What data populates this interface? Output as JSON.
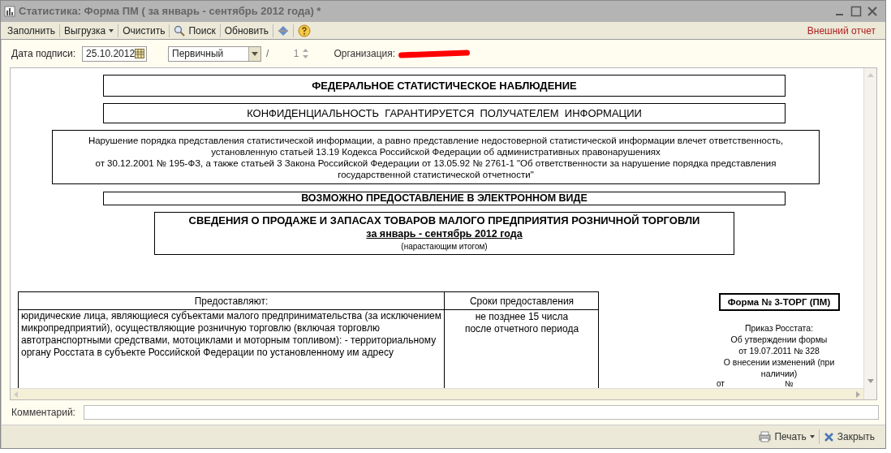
{
  "window": {
    "title": "Статистика: Форма ПМ ( за январь - сентябрь 2012 года) *"
  },
  "toolbar": {
    "items": [
      {
        "kind": "button",
        "label": "Заполнить"
      },
      {
        "kind": "dropdown",
        "label": "Выгрузка"
      },
      {
        "kind": "button",
        "label": "Очистить"
      },
      {
        "kind": "search",
        "label": "Поиск"
      },
      {
        "kind": "button",
        "label": "Обновить"
      },
      {
        "kind": "collapse"
      },
      {
        "kind": "help"
      }
    ],
    "right_link": "Внешний отчет"
  },
  "form": {
    "date_label": "Дата подписи:",
    "date_value": "25.10.2012",
    "type_value": "Первичный",
    "separator": "/",
    "number_value": "1",
    "org_label": "Организация:",
    "org_redacted": true
  },
  "report": {
    "blocks": [
      {
        "kind": "title",
        "text": "ФЕДЕРАЛЬНОЕ СТАТИСТИЧЕСКОЕ НАБЛЮДЕНИЕ"
      },
      {
        "kind": "plain",
        "text": "КОНФИДЕНЦИАЛЬНОСТЬ  ГАРАНТИРУЕТСЯ  ПОЛУЧАТЕЛЕМ  ИНФОРМАЦИИ"
      },
      {
        "kind": "notice",
        "lines": [
          "Нарушение порядка представления статистической информации, а равно представление недостоверной статистической информации влечет ответственность,",
          "установленную статьей 13.19 Кодекса Российской Федерации об административных правонарушениях",
          "от 30.12.2001 № 195-ФЗ, а также статьей 3 Закона Российской Федерации от 13.05.92 № 2761-1 \"Об ответственности за нарушение порядка представления",
          "государственной статистической отчетности\""
        ]
      },
      {
        "kind": "strip",
        "text": "ВОЗМОЖНО ПРЕДОСТАВЛЕНИЕ В ЭЛЕКТРОННОМ ВИДЕ"
      }
    ],
    "summary": {
      "title": "СВЕДЕНИЯ О ПРОДАЖЕ И ЗАПАСАХ ТОВАРОВ МАЛОГО ПРЕДПРИЯТИЯ РОЗНИЧНОЙ ТОРГОВЛИ",
      "period": "за январь - сентябрь 2012 года",
      "note": "(нарастающим итогом)"
    },
    "table": {
      "columns": [
        "Предоставляют:",
        "Сроки предоставления"
      ],
      "rows": [
        [
          "юридические лица, являющиеся субъектами малого предпринимательства (за исключением микропредприятий), осуществляющие розничную торговлю (включая торговлю автотранспортными средствами, мотоциклами и моторным топливом): - территориальному органу Росстата в субъекте Российской Федерации по установленному им адресу",
          "не позднее 15 числа\nпосле отчетного периода"
        ]
      ]
    },
    "form_number": "Форма № 3-ТОРГ (ПМ)",
    "order_lines": [
      "Приказ Росстата:",
      "Об утверждении формы",
      "от 19.07.2011 № 328",
      "О внесении изменений (при наличии)"
    ],
    "order_fields": [
      "от",
      "№"
    ]
  },
  "comment": {
    "label": "Комментарий:"
  },
  "footer": {
    "buttons": [
      {
        "kind": "print",
        "label": "Печать"
      },
      {
        "kind": "close",
        "label": "Закрыть"
      }
    ]
  }
}
